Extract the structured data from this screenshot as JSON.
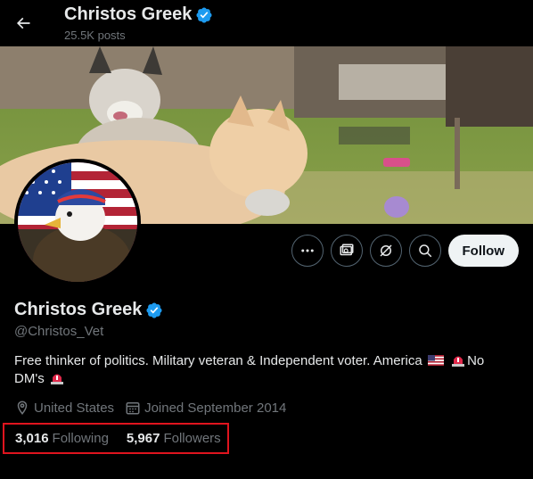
{
  "header": {
    "title": "Christos Greek",
    "posts": "25.5K posts"
  },
  "profile": {
    "display_name": "Christos Greek",
    "handle": "@Christos_Vet",
    "bio_text": "Free thinker of politics. Military veteran & Independent voter. America",
    "bio_after_siren": "No",
    "bio_line2": "DM's",
    "location": "United States",
    "joined": "Joined September 2014",
    "following_count": "3,016",
    "following_label": "Following",
    "followers_count": "5,967",
    "followers_label": "Followers",
    "verified_badge_color": "#1d9bf0"
  },
  "actions": {
    "follow_label": "Follow",
    "icons": [
      "more-icon",
      "subscribe-icon",
      "grok-icon",
      "search-icon"
    ]
  },
  "colors": {
    "background": "#000000",
    "text_primary": "#e7e9ea",
    "text_secondary": "#71767b",
    "highlight_box": "#e0141e"
  }
}
